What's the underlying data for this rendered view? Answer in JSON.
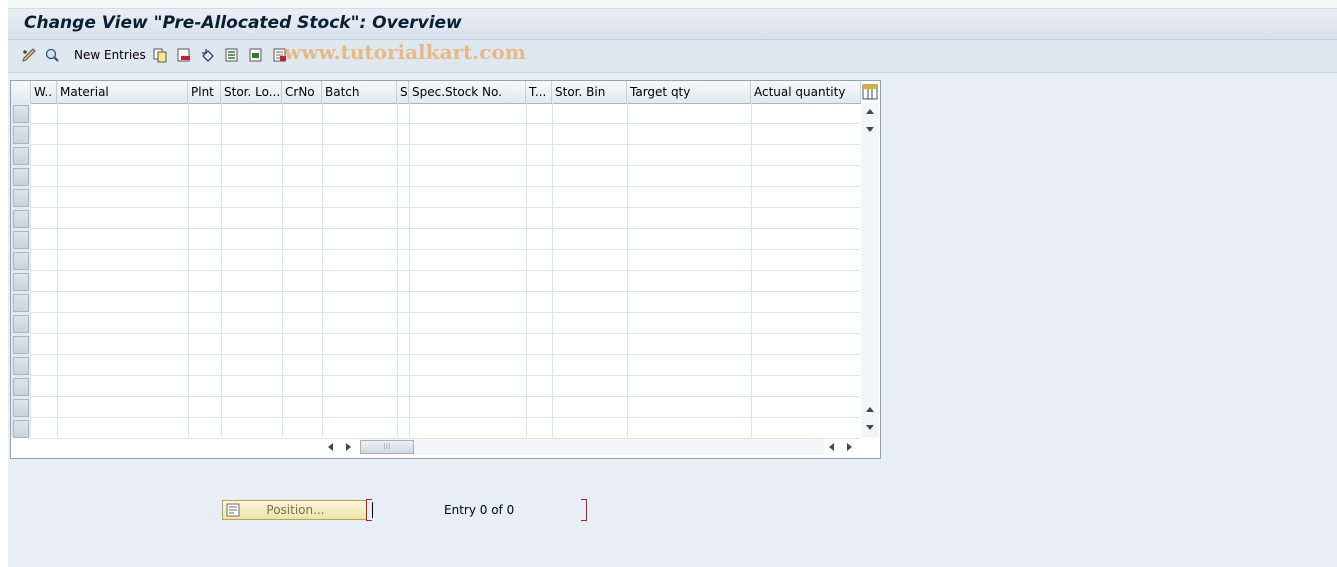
{
  "title": "Change View \"Pre-Allocated Stock\": Overview",
  "watermark": "www.tutorialkart.com",
  "toolbar": {
    "new_entries_label": "New Entries",
    "icons": [
      "edit-icon",
      "display-change-icon",
      "copy-icon",
      "delete-icon",
      "undo-icon",
      "select-all-icon",
      "select-block-icon",
      "deselect-all-icon"
    ]
  },
  "table": {
    "columns": [
      "W..",
      "Material",
      "Plnt",
      "Stor. Lo...",
      "CrNo",
      "Batch",
      "S",
      "Spec.Stock No.",
      "T...",
      "Stor. Bin",
      "Target qty",
      "Actual quantity"
    ],
    "rows": 16
  },
  "footer": {
    "position_button_label": "Position...",
    "entry_text": "Entry 0 of 0"
  },
  "colors": {
    "title": "#0d1e33",
    "accent_bracket": "#c0191b",
    "position_button": "#efe3a6"
  }
}
